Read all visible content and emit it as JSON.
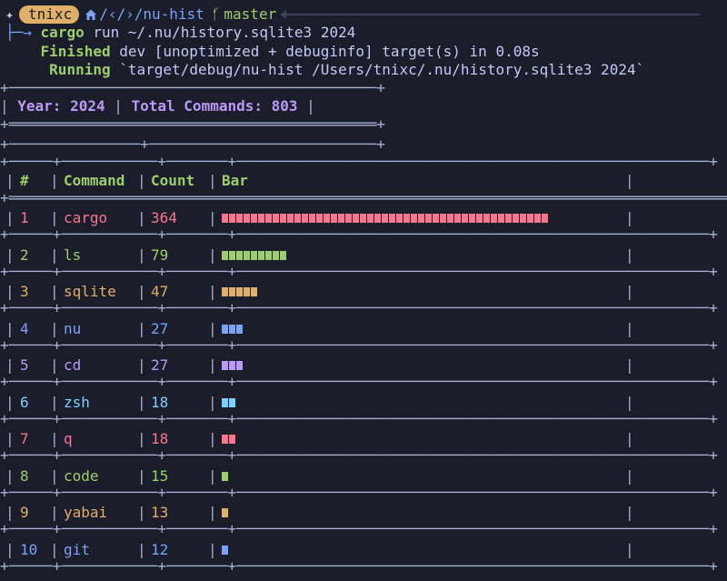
{
  "prompt": {
    "user": "tnixc",
    "path": "/‹/›/nu-hist",
    "branch": "master",
    "icons": [
      "sparkle-icon",
      "home-icon",
      "git-branch-icon",
      "left-arrow-line"
    ]
  },
  "command": {
    "tree_prefix": "├─→",
    "bin": "cargo",
    "args": "run ~/.nu/history.sqlite3 2024"
  },
  "cargo_output": {
    "finished_tag": "Finished",
    "finished_text": "dev [unoptimized + debuginfo] target(s) in 0.08s",
    "running_tag": "Running",
    "running_text": "`target/debug/nu-hist /Users/tnixc/.nu/history.sqlite3 2024`"
  },
  "summary": {
    "year_label": "Year: 2024",
    "total_label": "Total Commands: 803"
  },
  "table": {
    "headers": [
      "#",
      "Command",
      "Count",
      "Bar"
    ],
    "rows": [
      {
        "rank": "1",
        "command": "cargo",
        "count": "364",
        "bar_units": 45,
        "color": "#f7768e",
        "cls": "red"
      },
      {
        "rank": "2",
        "command": "ls",
        "count": "79",
        "bar_units": 9,
        "color": "#9ece6a",
        "cls": "green"
      },
      {
        "rank": "3",
        "command": "sqlite",
        "count": "47",
        "bar_units": 5,
        "color": "#e0af68",
        "cls": "orange"
      },
      {
        "rank": "4",
        "command": "nu",
        "count": "27",
        "bar_units": 3,
        "color": "#7aa2f7",
        "cls": "blue"
      },
      {
        "rank": "5",
        "command": "cd",
        "count": "27",
        "bar_units": 3,
        "color": "#bb9af7",
        "cls": "purple"
      },
      {
        "rank": "6",
        "command": "zsh",
        "count": "18",
        "bar_units": 2,
        "color": "#7dcfff",
        "cls": "cyan"
      },
      {
        "rank": "7",
        "command": "q",
        "count": "18",
        "bar_units": 2,
        "color": "#f7768e",
        "cls": "red"
      },
      {
        "rank": "8",
        "command": "code",
        "count": "15",
        "bar_units": 1,
        "color": "#9ece6a",
        "cls": "green"
      },
      {
        "rank": "9",
        "command": "yabai",
        "count": "13",
        "bar_units": 1,
        "color": "#e0af68",
        "cls": "orange"
      },
      {
        "rank": "10",
        "command": "git",
        "count": "12",
        "bar_units": 1,
        "color": "#7aa2f7",
        "cls": "blue"
      }
    ]
  },
  "colors": {
    "background": "#1b1d2b",
    "foreground": "#c0caf5",
    "accent_green": "#9ece6a",
    "accent_purple": "#bb9af7",
    "accent_orange": "#e0af68",
    "accent_blue": "#7aa2f7"
  }
}
